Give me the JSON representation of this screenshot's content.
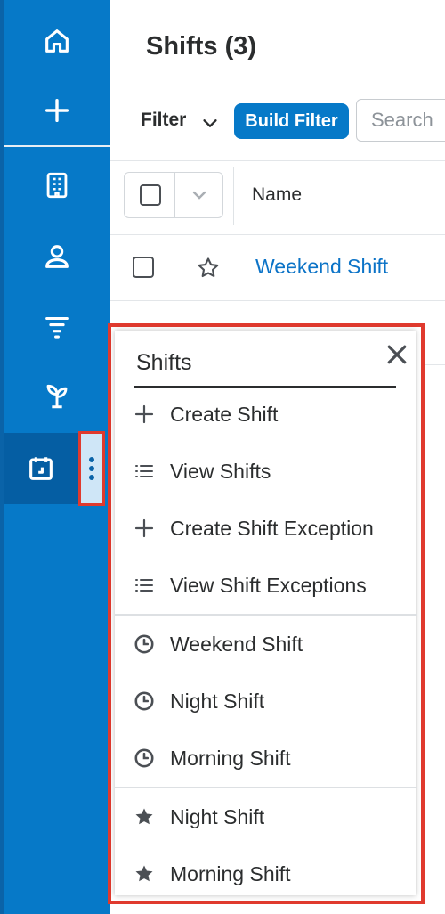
{
  "header": {
    "title": "Shifts (3)"
  },
  "toolbar": {
    "filter_label": "Filter",
    "build_filter_label": "Build Filter",
    "search_placeholder": "Search"
  },
  "table": {
    "columns": [
      "Name"
    ],
    "rows": [
      {
        "name": "Weekend Shift"
      }
    ]
  },
  "sidebar": {
    "items": [
      {
        "icon": "home-icon"
      },
      {
        "icon": "plus-icon"
      },
      {
        "icon": "building-icon"
      },
      {
        "icon": "person-icon"
      },
      {
        "icon": "filter-icon"
      },
      {
        "icon": "sprout-icon"
      },
      {
        "icon": "calendar-icon",
        "active": true
      }
    ]
  },
  "dropdown": {
    "title": "Shifts",
    "actions": [
      {
        "label": "Create Shift",
        "icon": "plus-icon"
      },
      {
        "label": "View Shifts",
        "icon": "list-icon"
      },
      {
        "label": "Create Shift Exception",
        "icon": "plus-icon"
      },
      {
        "label": "View Shift Exceptions",
        "icon": "list-icon"
      }
    ],
    "recent": [
      {
        "label": "Weekend Shift",
        "icon": "clock-icon"
      },
      {
        "label": "Night Shift",
        "icon": "clock-icon"
      },
      {
        "label": "Morning Shift",
        "icon": "clock-icon"
      }
    ],
    "favorites": [
      {
        "label": "Night Shift",
        "icon": "star-icon"
      },
      {
        "label": "Morning Shift",
        "icon": "star-icon"
      }
    ]
  },
  "colors": {
    "brand": "#0679c8",
    "highlight": "#e03a2e",
    "link": "#0b73c7"
  }
}
